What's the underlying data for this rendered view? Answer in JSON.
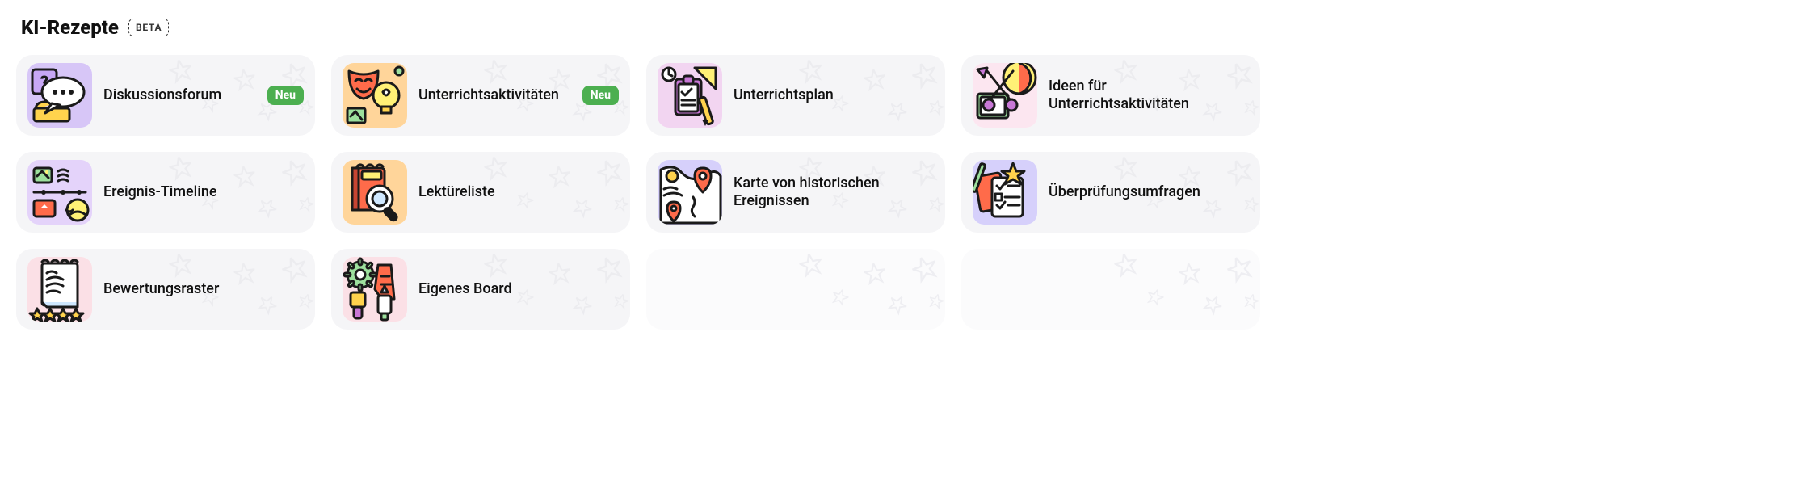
{
  "header": {
    "title": "KI-Rezepte",
    "badge": "BETA"
  },
  "new_label": "Neu",
  "cards": [
    {
      "id": "discussion-forum",
      "label": "Diskussionsforum",
      "new": true,
      "icon": "question-speech-icon",
      "bg": "#d7c6f7"
    },
    {
      "id": "class-activities",
      "label": "Unterrichtsaktivitäten",
      "new": true,
      "icon": "masks-bulb-icon",
      "bg": "#ffd59a"
    },
    {
      "id": "lesson-plan",
      "label": "Unterrichtsplan",
      "new": false,
      "icon": "clipboard-ruler-icon",
      "bg": "#f2d5f1"
    },
    {
      "id": "activity-ideas",
      "label": "Ideen für Unterrichtsaktivitäten",
      "new": false,
      "icon": "scissors-craft-icon",
      "bg": "#fce6f0"
    },
    {
      "id": "event-timeline",
      "label": "Ereignis-Timeline",
      "new": false,
      "icon": "timeline-icon",
      "bg": "#e4d3fa"
    },
    {
      "id": "reading-list",
      "label": "Lektüreliste",
      "new": false,
      "icon": "book-magnify-icon",
      "bg": "#ffd59a"
    },
    {
      "id": "historical-map",
      "label": "Karte von historischen Ereignissen",
      "new": false,
      "icon": "map-pins-icon",
      "bg": "#d6d0fb"
    },
    {
      "id": "review-surveys",
      "label": "Überprüfungsumfragen",
      "new": false,
      "icon": "checklist-star-icon",
      "bg": "#d6d0fb"
    },
    {
      "id": "rubric",
      "label": "Bewertungsraster",
      "new": false,
      "icon": "rubric-stars-icon",
      "bg": "#fbe0e6"
    },
    {
      "id": "custom-board",
      "label": "Eigenes Board",
      "new": false,
      "icon": "paint-tools-icon",
      "bg": "#fbe0e6"
    },
    {
      "id": "placeholder-1",
      "placeholder": true
    },
    {
      "id": "placeholder-2",
      "placeholder": true
    }
  ]
}
